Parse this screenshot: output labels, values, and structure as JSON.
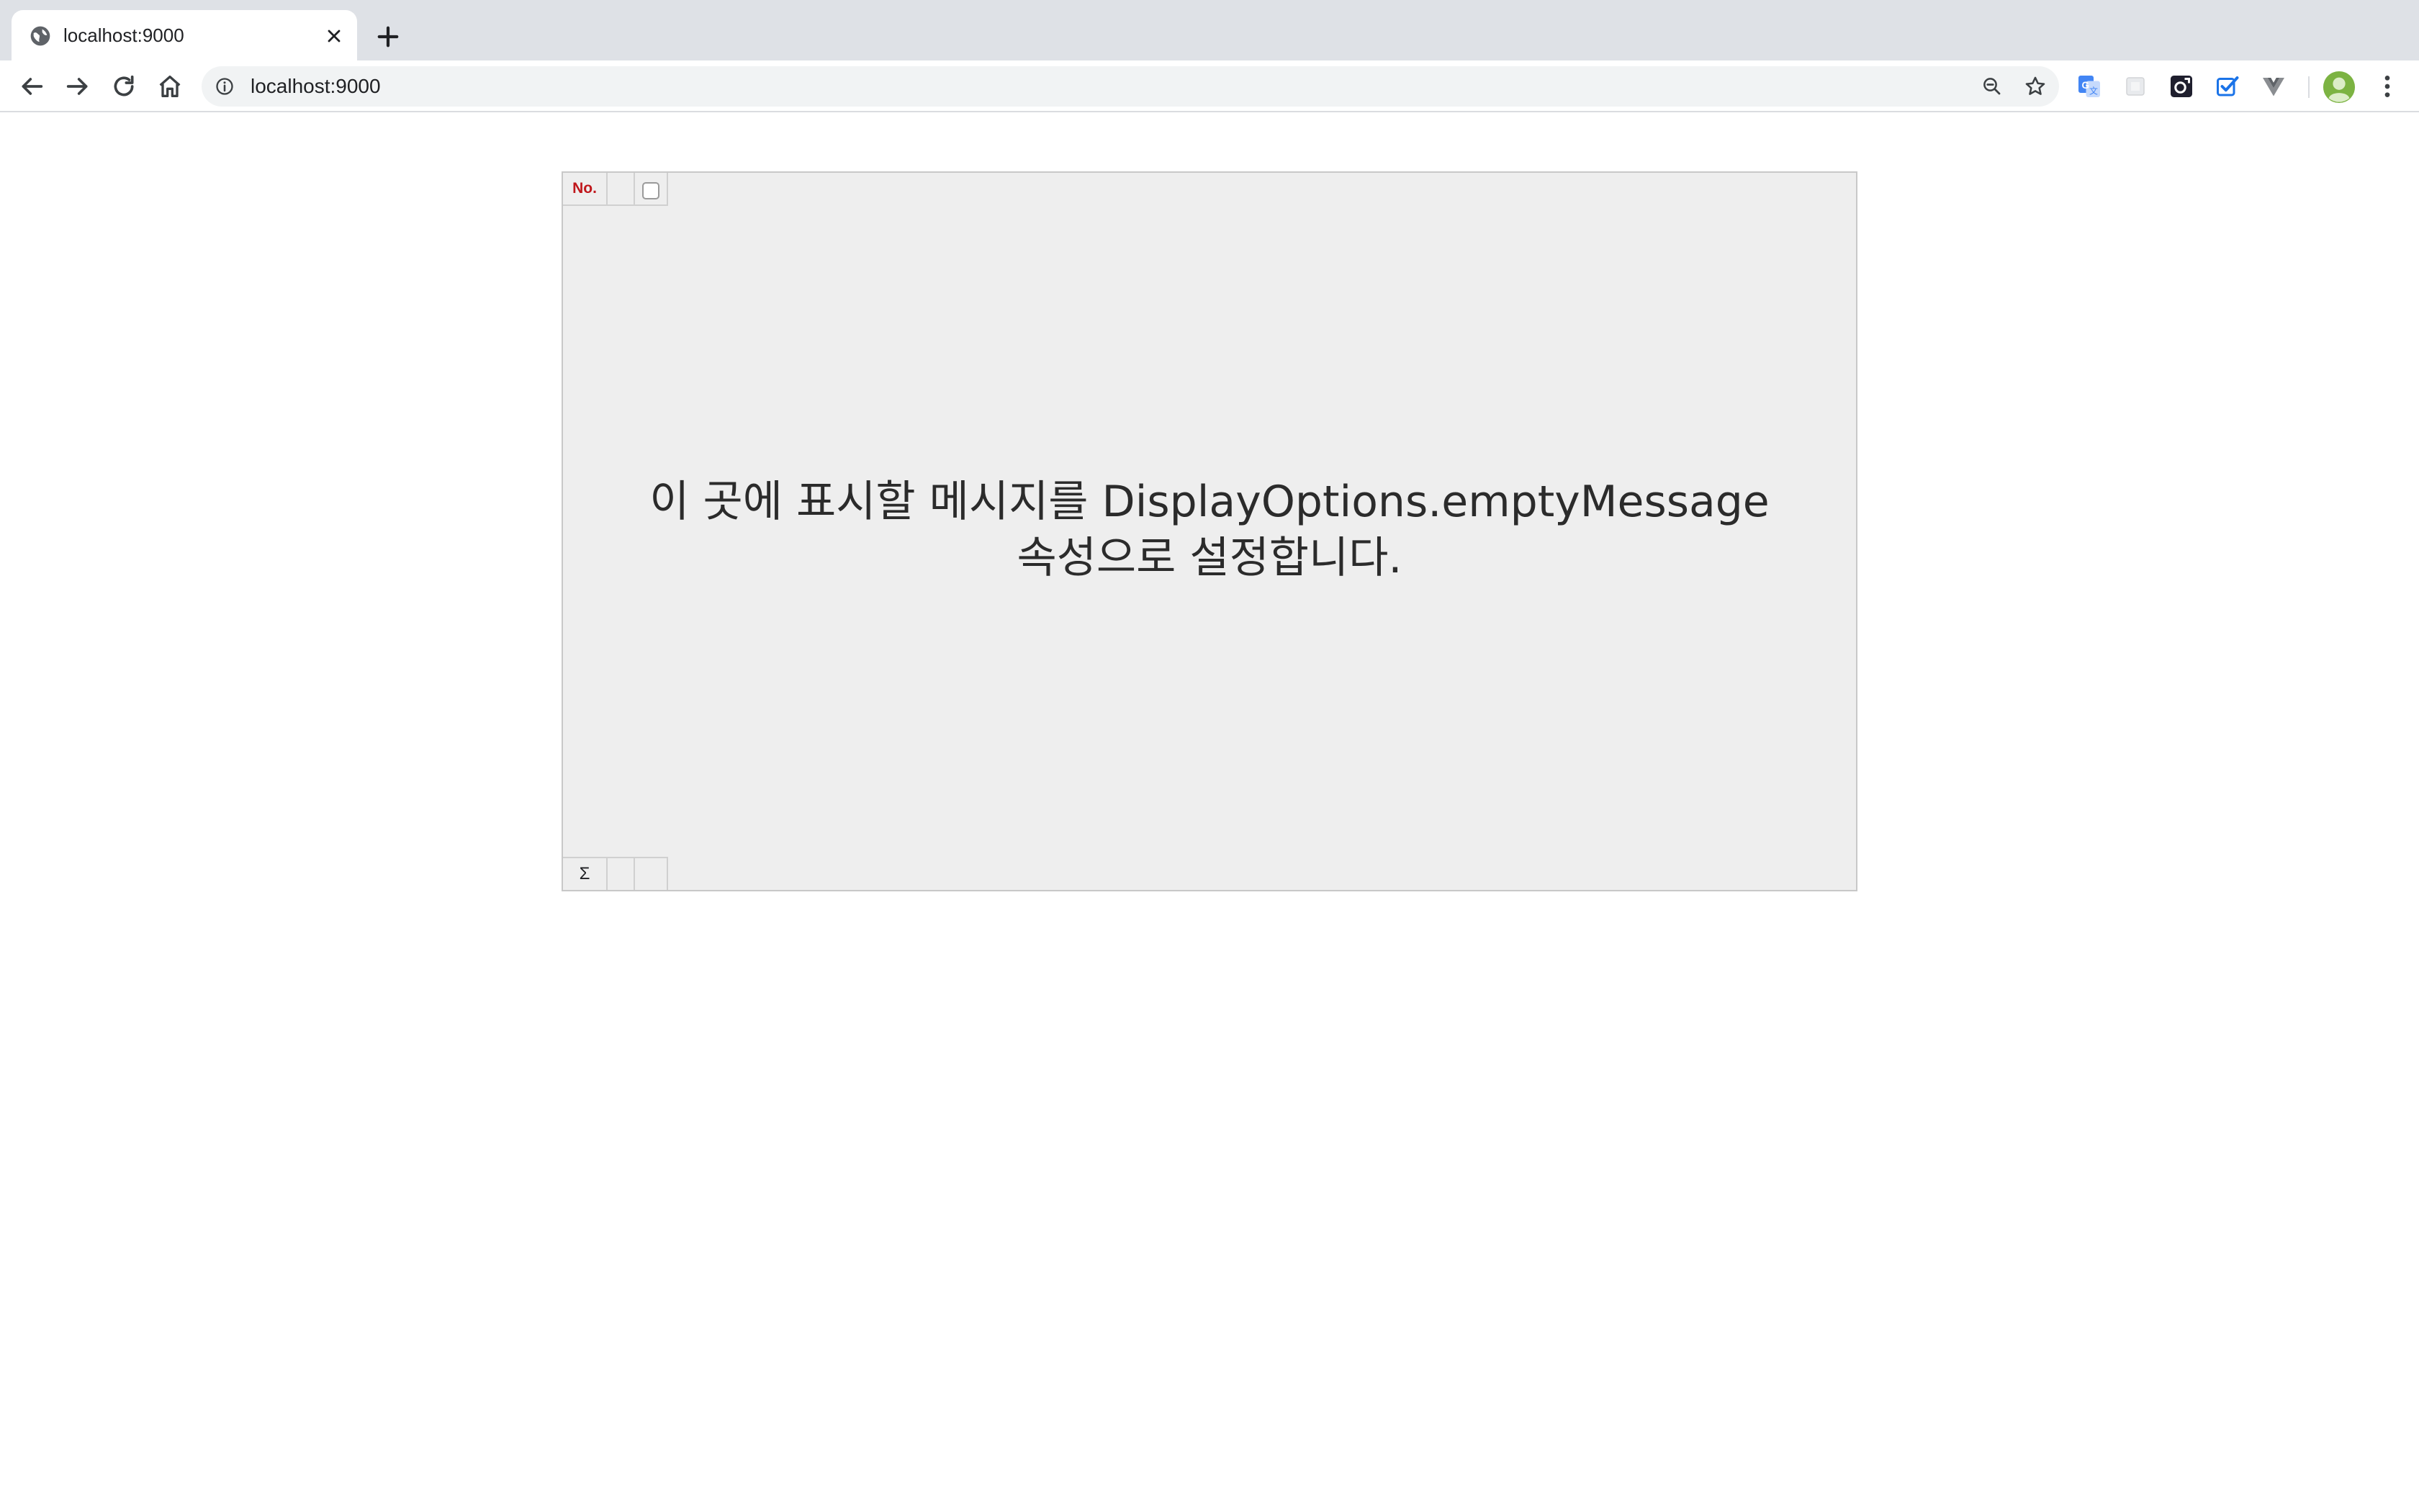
{
  "browser": {
    "tab": {
      "title": "localhost:9000",
      "favicon": "globe-icon"
    },
    "address_bar": {
      "url": "localhost:9000"
    },
    "toolbar_icons": [
      "back-arrow-icon",
      "forward-arrow-icon",
      "reload-icon",
      "home-icon",
      "site-info-icon",
      "zoom-out-icon",
      "bookmark-star-icon"
    ],
    "extensions": [
      "google-translate-icon",
      "blank-extension-icon",
      "camera-extension-icon",
      "checkbox-extension-icon",
      "vue-devtools-icon"
    ],
    "accent_color": "#1a73e8"
  },
  "grid": {
    "header": {
      "row_number_label": "No.",
      "row_number_color": "#c0171c"
    },
    "empty_message": {
      "line1": "이 곳에 표시할 메시지를 DisplayOptions.emptyMessage",
      "line2": "속성으로 설정합니다."
    },
    "footer": {
      "sum_label": "Σ"
    },
    "background": "#eeeeee"
  }
}
